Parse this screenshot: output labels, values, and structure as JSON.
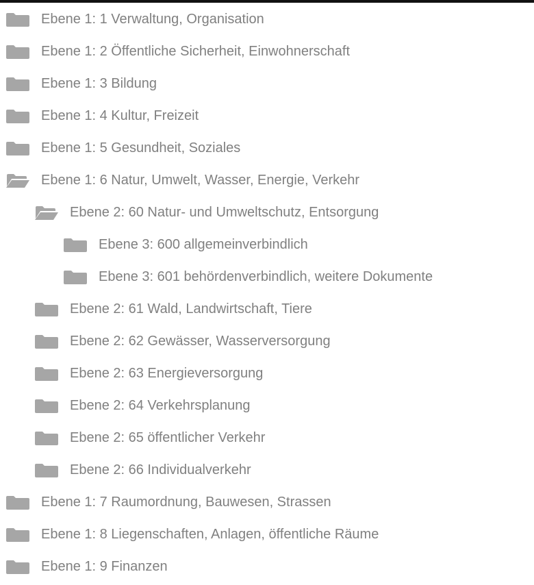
{
  "colors": {
    "icon": "#a6a6a6",
    "text": "#808080",
    "top_border": "#111111"
  },
  "tree": {
    "items": [
      {
        "label": "Ebene 1: 1 Verwaltung, Organisation",
        "level": 1,
        "icon": "folder-icon"
      },
      {
        "label": "Ebene 1: 2 Öffentliche Sicherheit, Einwohnerschaft",
        "level": 1,
        "icon": "folder-icon"
      },
      {
        "label": "Ebene 1: 3 Bildung",
        "level": 1,
        "icon": "folder-icon"
      },
      {
        "label": "Ebene 1: 4 Kultur, Freizeit",
        "level": 1,
        "icon": "folder-icon"
      },
      {
        "label": "Ebene 1: 5 Gesundheit, Soziales",
        "level": 1,
        "icon": "folder-icon"
      },
      {
        "label": "Ebene 1: 6 Natur, Umwelt, Wasser, Energie, Verkehr",
        "level": 1,
        "icon": "folder-open-icon"
      },
      {
        "label": "Ebene 2: 60 Natur- und Umweltschutz, Entsorgung",
        "level": 2,
        "icon": "folder-open-icon"
      },
      {
        "label": "Ebene 3: 600 allgemeinverbindlich",
        "level": 3,
        "icon": "folder-icon"
      },
      {
        "label": "Ebene 3: 601 behördenverbindlich, weitere Dokumente",
        "level": 3,
        "icon": "folder-icon"
      },
      {
        "label": "Ebene 2: 61 Wald, Landwirtschaft, Tiere",
        "level": 2,
        "icon": "folder-icon"
      },
      {
        "label": "Ebene 2: 62 Gewässer, Wasserversorgung",
        "level": 2,
        "icon": "folder-icon"
      },
      {
        "label": "Ebene 2: 63 Energieversorgung",
        "level": 2,
        "icon": "folder-icon"
      },
      {
        "label": "Ebene 2: 64 Verkehrsplanung",
        "level": 2,
        "icon": "folder-icon"
      },
      {
        "label": "Ebene 2: 65 öffentlicher Verkehr",
        "level": 2,
        "icon": "folder-icon"
      },
      {
        "label": "Ebene 2: 66 Individualverkehr",
        "level": 2,
        "icon": "folder-icon"
      },
      {
        "label": "Ebene 1: 7 Raumordnung, Bauwesen, Strassen",
        "level": 1,
        "icon": "folder-icon"
      },
      {
        "label": "Ebene 1: 8 Liegenschaften, Anlagen, öffentliche Räume",
        "level": 1,
        "icon": "folder-icon"
      },
      {
        "label": "Ebene 1: 9 Finanzen",
        "level": 1,
        "icon": "folder-icon"
      }
    ]
  }
}
